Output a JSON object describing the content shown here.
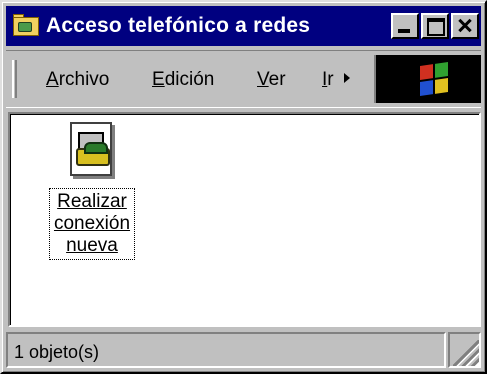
{
  "window": {
    "title": "Acceso telefónico a redes",
    "title_icon": "dialup-folder-icon",
    "buttons": [
      "minimize",
      "maximize",
      "close"
    ]
  },
  "menubar": {
    "items": [
      {
        "label": "Archivo",
        "accel": "A",
        "rest": "rchivo"
      },
      {
        "label": "Edición",
        "accel": "E",
        "rest": "dición"
      },
      {
        "label": "Ver",
        "accel": "V",
        "rest": "er"
      },
      {
        "label": "Ir",
        "accel": "I",
        "rest": "r"
      }
    ],
    "overflow_icon": "chevron-right-icon",
    "brand_icon": "windows-logo-icon"
  },
  "content": {
    "items": [
      {
        "label_lines": [
          "Realizar",
          "conexión",
          "nueva"
        ],
        "icon": "make-new-connection-icon",
        "selected": true
      }
    ]
  },
  "statusbar": {
    "text": "1 objeto(s)"
  },
  "colors": {
    "titlebar": "#000080",
    "face": "#c0c0c0",
    "content_bg": "#ffffff"
  }
}
